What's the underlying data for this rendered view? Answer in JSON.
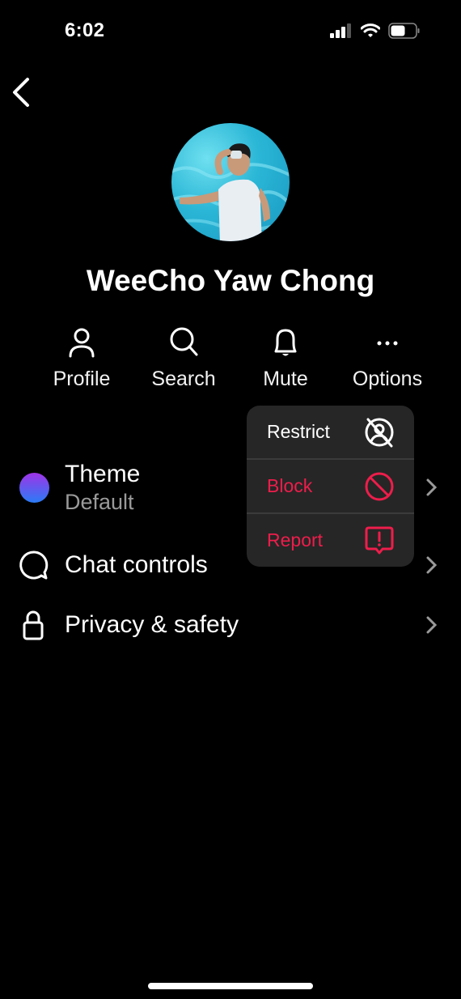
{
  "status_bar": {
    "time": "6:02",
    "icons": [
      "cellular-signal-icon",
      "wifi-icon",
      "battery-icon"
    ]
  },
  "header": {
    "back_icon": "chevron-left-icon"
  },
  "profile": {
    "name": "WeeCho Yaw Chong",
    "avatar": "profile-photo"
  },
  "actions": [
    {
      "label": "Profile",
      "icon": "person-icon"
    },
    {
      "label": "Search",
      "icon": "search-icon"
    },
    {
      "label": "Mute",
      "icon": "bell-icon"
    },
    {
      "label": "Options",
      "icon": "more-horizontal-icon"
    }
  ],
  "settings": [
    {
      "label": "Theme",
      "value": "Default",
      "icon": "theme-gradient-circle"
    },
    {
      "label": "Chat controls",
      "icon": "chat-bubble-icon"
    },
    {
      "label": "Privacy & safety",
      "icon": "lock-icon"
    }
  ],
  "options_menu": {
    "items": [
      {
        "label": "Restrict",
        "icon": "restrict-icon",
        "color": "#ffffff"
      },
      {
        "label": "Block",
        "icon": "block-icon",
        "color": "#ee1d4b"
      },
      {
        "label": "Report",
        "icon": "report-icon",
        "color": "#ee1d4b"
      }
    ]
  },
  "colors": {
    "background": "#000000",
    "menu": "#262626",
    "danger": "#ee1d4b",
    "secondary_text": "#9a9a9a"
  }
}
